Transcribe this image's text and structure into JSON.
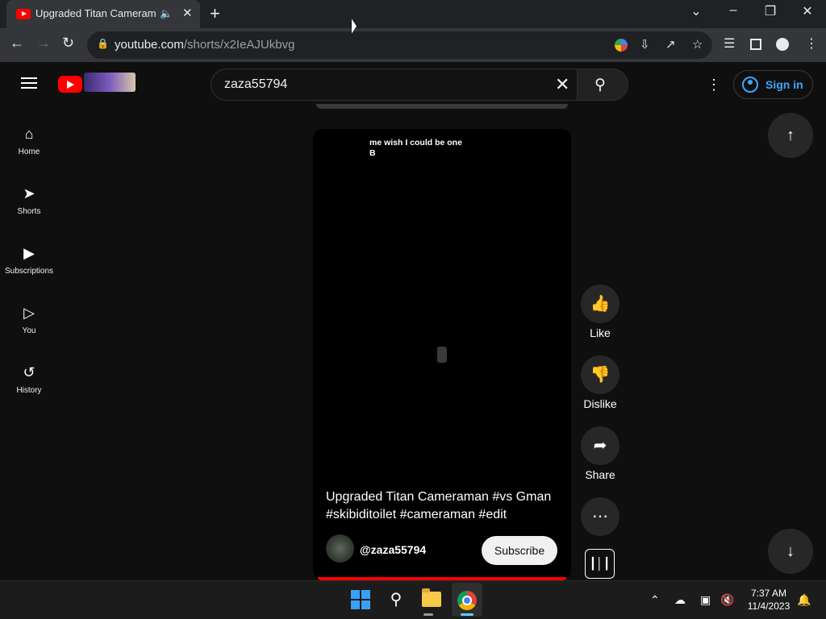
{
  "browser": {
    "tab_title": "Upgraded Titan Cameraman",
    "tab_audio_icon": "speaker-icon",
    "url_host": "youtube.com",
    "url_path": "/shorts/x2IeAJUkbvg"
  },
  "youtube": {
    "search_value": "zaza55794",
    "sign_in_label": "Sign in",
    "sidebar": [
      {
        "label": "Home",
        "icon": "home-icon"
      },
      {
        "label": "Shorts",
        "icon": "shorts-icon"
      },
      {
        "label": "Subscriptions",
        "icon": "subscriptions-icon"
      },
      {
        "label": "You",
        "icon": "you-icon"
      },
      {
        "label": "History",
        "icon": "history-icon"
      }
    ],
    "short": {
      "caption_line1": "me wish I could be one",
      "caption_line2": "B",
      "title": "Upgraded Titan Cameraman #vs Gman #skibiditoilet #cameraman #edit",
      "channel": "@zaza55794",
      "subscribe_label": "Subscribe",
      "progress": 1.0
    },
    "actions": {
      "like": "Like",
      "dislike": "Dislike",
      "share": "Share"
    }
  },
  "taskbar": {
    "time": "7:37 AM",
    "date": "11/4/2023"
  },
  "colors": {
    "youtube_red": "#ff0000",
    "link_blue": "#3ea6ff",
    "background": "#0f0f0f"
  }
}
